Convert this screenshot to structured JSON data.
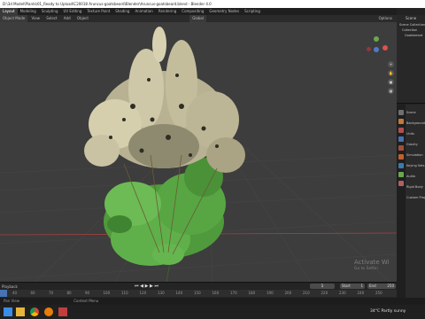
{
  "window": {
    "title": "D:\\3d Model\\Plants\\01_Ready to Upload\\C20018 Aruncus-goatsbeard\\Blender\\Aruncus-goatsbeard.blend - Blender 4.0"
  },
  "menubar": {
    "tabs": [
      "Layout",
      "Modeling",
      "Sculpting",
      "UV Editing",
      "Texture Paint",
      "Shading",
      "Animation",
      "Rendering",
      "Compositing",
      "Geometry Nodes",
      "Scripting"
    ],
    "active": "Layout"
  },
  "toolbar": {
    "mode": "Object Mode",
    "view": "View",
    "select": "Select",
    "add": "Add",
    "object": "Object",
    "transform": "Global",
    "options": "Options"
  },
  "outliner": {
    "header": "Scene",
    "items": [
      "Scene Collection",
      "Collection",
      "Goatsbeard"
    ]
  },
  "properties": {
    "header": "Scene",
    "rows": [
      "Scene",
      "Background",
      "Units",
      "Gravity",
      "Simulation",
      "Keying Sets",
      "Audio",
      "Rigid Body",
      "Custom Props"
    ]
  },
  "timeline": {
    "playback": "Playback",
    "keying": "Keying",
    "view": "View",
    "marker": "Marker",
    "current_frame": "1",
    "start_label": "Start",
    "start": "1",
    "end_label": "End",
    "end": "250",
    "ruler_ticks": [
      "40",
      "60",
      "70",
      "80",
      "90",
      "100",
      "110",
      "120",
      "130",
      "140",
      "150",
      "160",
      "170",
      "180",
      "190",
      "200",
      "210",
      "220",
      "230",
      "240",
      "250"
    ]
  },
  "watermark": {
    "line1": "Activate Wi",
    "line2": "Go to Settin"
  },
  "statusbar": {
    "left": "Pan View",
    "right": "Context Menu"
  },
  "taskbar": {
    "weather": "34°C  Partly sunny",
    "apps": [
      "start-icon",
      "file-explorer-icon",
      "chrome-icon",
      "blender-icon",
      "app-icon"
    ]
  },
  "colors": {
    "accent": "#4772b3",
    "viewport_bg": "#3d3d3d",
    "foliage_green": "#5fb04a",
    "foliage_cream": "#c9c3a4",
    "axis_red": "#a34040"
  }
}
